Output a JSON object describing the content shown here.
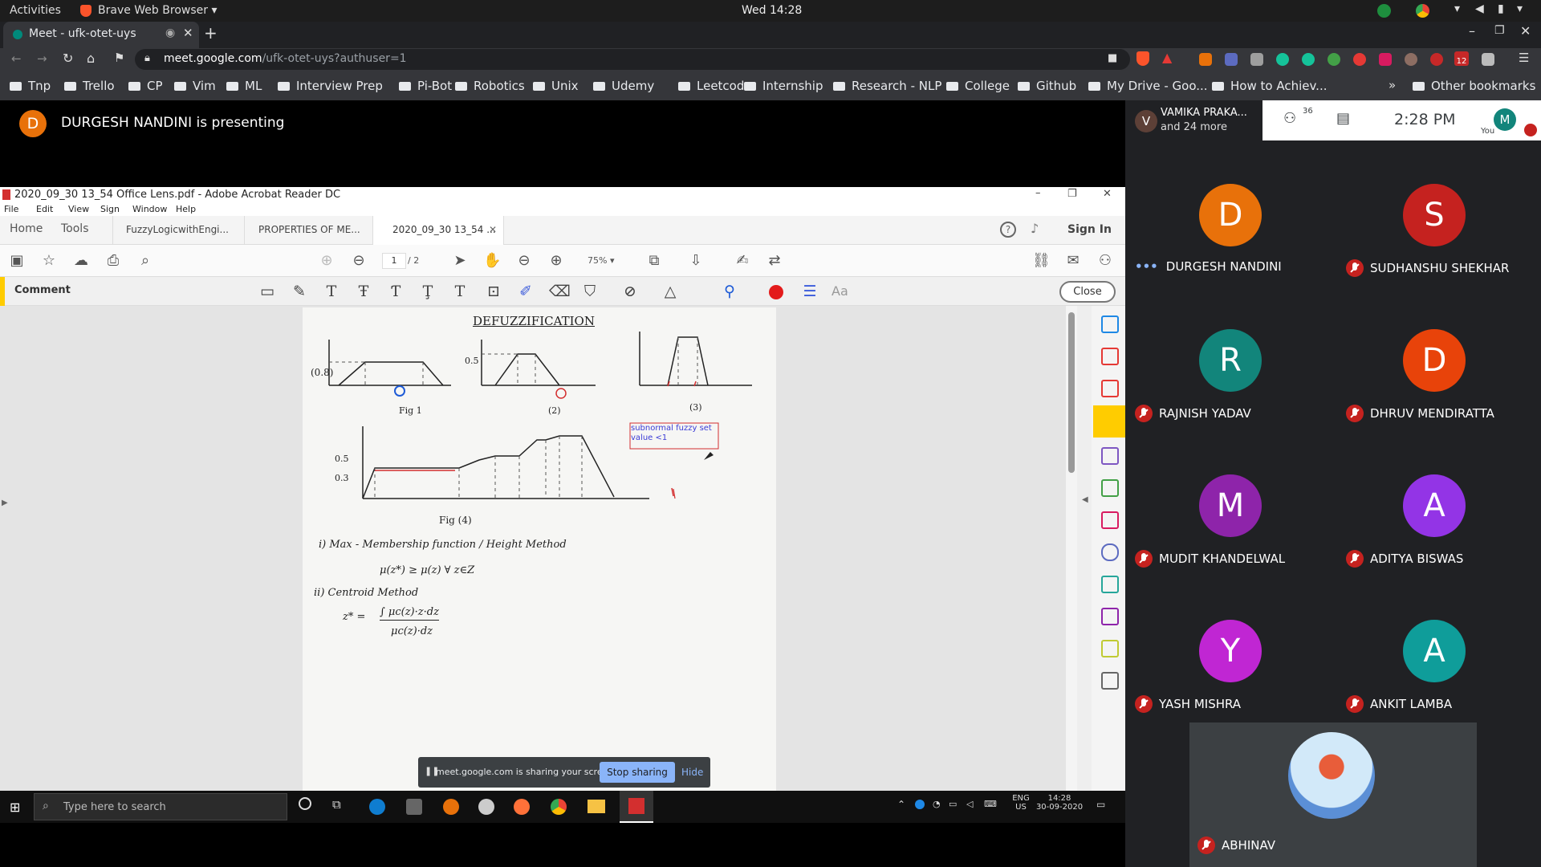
{
  "gnome": {
    "activities": "Activities",
    "app": "Brave Web Browser",
    "clock": "Wed 14:28"
  },
  "tab": {
    "title": "Meet - ufk-otet-uys"
  },
  "address": {
    "host": "meet.google.com",
    "path": "/ufk-otet-uys?authuser=1"
  },
  "ext_badge": "12",
  "bookmarks": [
    "Tnp",
    "Trello",
    "CP",
    "Vim",
    "ML",
    "Interview Prep",
    "Pi-Bot",
    "Robotics",
    "Unix",
    "Udemy",
    "Leetcode",
    "Internship",
    "Research - NLP",
    "College",
    "Github",
    "My Drive - Goo...",
    "How to Achiev..."
  ],
  "bookmarks_more": "»",
  "other_bookmarks": "Other bookmarks",
  "meet": {
    "presenter_initial": "D",
    "presenting_text": "DURGESH NANDINI is presenting",
    "header_name": "VAMIKA PRAKA...",
    "header_more": "and 24 more",
    "people_count": "36",
    "time": "2:28 PM",
    "you_initial": "M",
    "you_label": "You",
    "participants": [
      {
        "initial": "D",
        "name": "DURGESH NANDINI",
        "color": "#e8710a",
        "muted": false
      },
      {
        "initial": "S",
        "name": "SUDHANSHU SHEKHAR",
        "color": "#c5221f",
        "muted": true
      },
      {
        "initial": "R",
        "name": "RAJNISH YADAV",
        "color": "#12857b",
        "muted": true
      },
      {
        "initial": "D",
        "name": "DHRUV MENDIRATTA",
        "color": "#e8430a",
        "muted": true
      },
      {
        "initial": "M",
        "name": "MUDIT KHANDELWAL",
        "color": "#8e24aa",
        "muted": true
      },
      {
        "initial": "A",
        "name": "ADITYA BISWAS",
        "color": "#9334e6",
        "muted": true
      },
      {
        "initial": "Y",
        "name": "YASH MISHRA",
        "color": "#c026d3",
        "muted": true
      },
      {
        "initial": "A",
        "name": "ANKIT LAMBA",
        "color": "#0f9d9a",
        "muted": true
      }
    ],
    "abhinav": "ABHINAV"
  },
  "acrobat": {
    "title": "2020_09_30 13_54 Office Lens.pdf - Adobe Acrobat Reader DC",
    "menu": [
      "File",
      "Edit",
      "View",
      "Sign",
      "Window",
      "Help"
    ],
    "nav": [
      "Home",
      "Tools"
    ],
    "doc_tabs": [
      "FuzzyLogicwithEngi...",
      "PROPERTIES OF ME...",
      "2020_09_30 13_54 ..."
    ],
    "sign_in": "Sign In",
    "page_current": "1",
    "page_total": "/ 2",
    "zoom": "75%",
    "comment": "Comment",
    "close": "Close",
    "annotation": "subnormal fuzzy set value <1"
  },
  "share_bar": {
    "text": "meet.google.com is sharing your screen.",
    "stop": "Stop sharing",
    "hide": "Hide"
  },
  "taskbar": {
    "search_placeholder": "Type here to search",
    "lang": "ENG",
    "region": "US",
    "time": "14:28",
    "date": "30-09-2020"
  },
  "notes": {
    "title": "DEFUZZIFICATION",
    "fig1": "Fig 1",
    "fig2": "(2)",
    "fig3": "(3)",
    "fig4": "Fig (4)",
    "mu_y_labels": [
      "(0.8)",
      "0.5",
      "0.5",
      "0.3"
    ],
    "method1": "i) Max - Membership function / Height Method",
    "method1_eq": "μ(z*) ≥ μ(z) ∀ z∈Z",
    "method2": "ii) Centroid Method",
    "method2_lhs": "z* =",
    "method2_num": "∫ μc(z)·z·dz",
    "method2_den": "μc(z)·dz"
  }
}
